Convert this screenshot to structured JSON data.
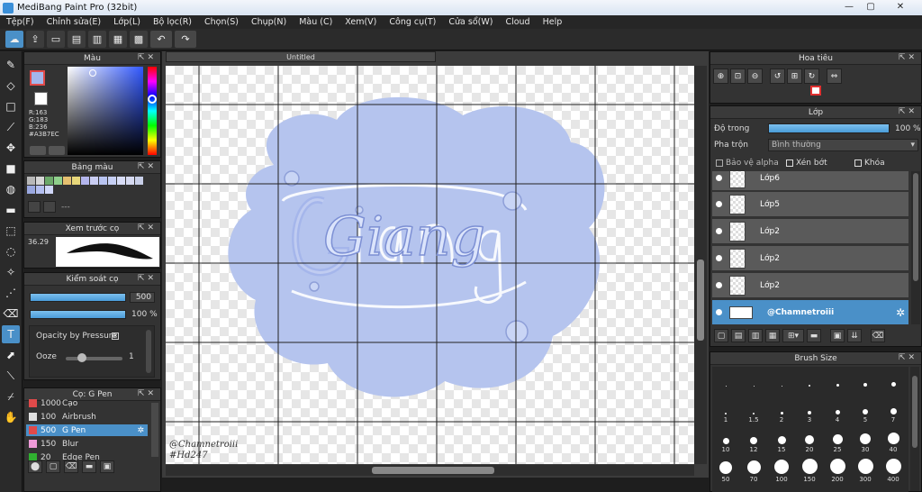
{
  "window": {
    "title": "MediBang Paint Pro (32bit)",
    "minimize": "—",
    "maximize": "▢",
    "close": "✕"
  },
  "menu": [
    "Tệp(F)",
    "Chỉnh sửa(E)",
    "Lớp(L)",
    "Bộ lọc(R)",
    "Chọn(S)",
    "Chụp(N)",
    "Màu (C)",
    "Xem(V)",
    "Công cụ(T)",
    "Cửa sổ(W)",
    "Cloud",
    "Help"
  ],
  "color_panel": {
    "title": "Màu",
    "foreground": "#A3B7EC",
    "r": "R:163",
    "g": "G:183",
    "b": "B:236",
    "hex": "#A3B7EC"
  },
  "palette_panel": {
    "title": "Bảng màu",
    "placeholder": "---",
    "swatches_row1": [
      "#b8b8b8",
      "#d6d6d6",
      "#6ca96a",
      "#8fd08c",
      "#e5c070",
      "#e7d77a",
      "#b3b5ec",
      "#c9cdf2",
      "#b8c3f0",
      "#c6cff4",
      "#d7dcf6",
      "#d5d9f0",
      "#c8cfe8"
    ],
    "swatches_row2": [
      "#9aa8e0",
      "#b4bff0",
      "#d0d7f8"
    ]
  },
  "brush_preview": {
    "title": "Xem trước cọ",
    "scale": "36.29"
  },
  "brush_control": {
    "title": "Kiểm soát cọ",
    "size_value": "500",
    "opacity_value": "100",
    "opacity_unit": "%",
    "opacity_by_pressure": "Opacity by Pressure",
    "ooze_label": "Ooze",
    "ooze_value": "1"
  },
  "brush_list": {
    "title": "Cọ: G Pen",
    "items": [
      {
        "size": "1000",
        "name": "Cạo",
        "color": "#e04a4a"
      },
      {
        "size": "100",
        "name": "Airbrush",
        "color": "#e0e0e0"
      },
      {
        "size": "500",
        "name": "G Pen",
        "color": "#e04a4a",
        "selected": true
      },
      {
        "size": "150",
        "name": "Blur",
        "color": "#ee9ad8"
      },
      {
        "size": "20",
        "name": "Edge Pen",
        "color": "#30b030"
      }
    ]
  },
  "canvas": {
    "tab": "Untitled",
    "watermark_line1": "@Chamnetroiii",
    "watermark_line2": "#Hd247",
    "lettering": "Giang"
  },
  "navigator": {
    "title": "Hoa tiêu"
  },
  "layer_panel": {
    "title": "Lớp",
    "opacity_label": "Độ trong",
    "opacity_value": "100 %",
    "blend_label": "Pha trộn",
    "blend_value": "Bình thường",
    "protect_alpha": "Bảo vệ alpha",
    "clipping": "Xén bớt",
    "lock": "Khóa",
    "layers": [
      {
        "name": "Lớp6"
      },
      {
        "name": "Lớp5"
      },
      {
        "name": "Lớp2"
      },
      {
        "name": "Lớp2"
      },
      {
        "name": "Lớp2"
      },
      {
        "name": "@Chamnetroiii",
        "selected": true
      }
    ]
  },
  "brush_size_panel": {
    "title": "Brush Size",
    "sizes": [
      "",
      "",
      "",
      "",
      "",
      "",
      "",
      "1",
      "1.5",
      "2",
      "3",
      "4",
      "5",
      "7",
      "10",
      "12",
      "15",
      "20",
      "25",
      "30",
      "40",
      "50",
      "70",
      "100",
      "150",
      "200",
      "300",
      "400"
    ]
  }
}
